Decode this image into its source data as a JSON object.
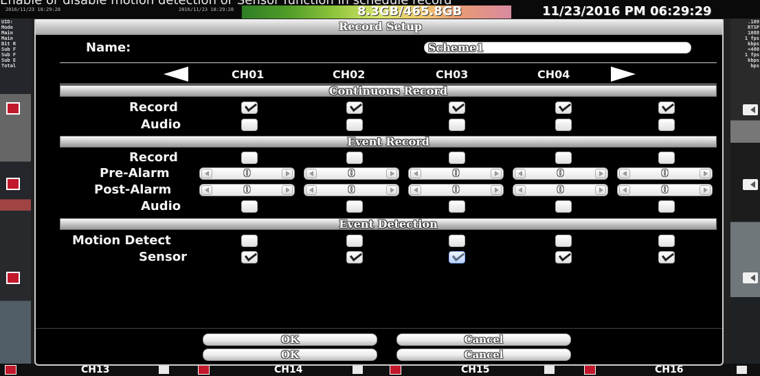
{
  "background": {
    "hint_text": "Enable or disable motion detection or Sensor function in schedule record",
    "disk_usage": "8.3GB/465.8GB",
    "datetime": "11/23/2016 PM 06:29:29",
    "small_top_left": "2016/11/23 18:29:28",
    "small_top_mid": "2016/11/23 18:29:28",
    "left_status_lines": [
      "UID:",
      "Mode",
      "Main",
      "Main",
      "Bit R",
      "Sub F",
      "Sub F",
      "Sub E",
      "Total"
    ],
    "right_status_lines": [
      ".109",
      "RTSP",
      "1088",
      "1 fps",
      "kbps",
      "<480",
      "1 fps",
      "kbps",
      "bps"
    ],
    "bottom_channels": [
      "CH13",
      "CH14",
      "CH15",
      "CH16"
    ]
  },
  "dialog": {
    "title": "Record Setup",
    "name_label": "Name:",
    "name_value": "Scheme1",
    "channels": [
      "CH01",
      "CH02",
      "CH03",
      "CH04"
    ],
    "sections": {
      "continuous": "Continuous Record",
      "event": "Event Record",
      "detection": "Event Detection"
    },
    "rows": {
      "record": "Record",
      "audio": "Audio",
      "pre_alarm": "Pre-Alarm",
      "post_alarm": "Post-Alarm",
      "motion_detect": "Motion Detect",
      "sensor": "Sensor"
    },
    "values": {
      "pre_alarm": [
        "0",
        "0",
        "0",
        "0",
        "0"
      ],
      "post_alarm": [
        "0",
        "0",
        "0",
        "0",
        "0"
      ]
    },
    "checks": {
      "continuous_record": [
        true,
        true,
        true,
        true,
        true
      ],
      "continuous_audio": [
        false,
        false,
        false,
        false,
        false
      ],
      "event_record": [
        false,
        false,
        false,
        false,
        false
      ],
      "event_audio": [
        false,
        false,
        false,
        false,
        false
      ],
      "motion_detect": [
        false,
        false,
        false,
        false,
        false
      ],
      "sensor": [
        true,
        true,
        true,
        true,
        true
      ]
    },
    "buttons": {
      "ok": "OK",
      "cancel": "Cancel"
    }
  }
}
